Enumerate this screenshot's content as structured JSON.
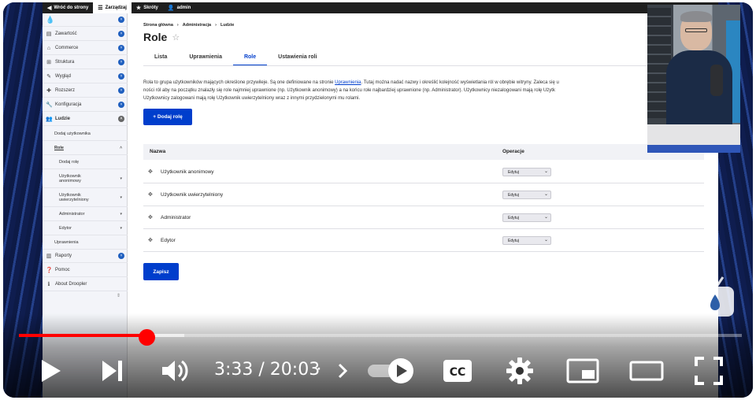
{
  "admin_toolbar": {
    "back": "Wróć do strony",
    "manage": "Zarządzaj",
    "shortcuts": "Skróty",
    "user": "admin"
  },
  "sidebar": {
    "items": [
      {
        "label": "Zawartość",
        "icon": "document-icon"
      },
      {
        "label": "Commerce",
        "icon": "commerce-icon"
      },
      {
        "label": "Struktura",
        "icon": "structure-icon"
      },
      {
        "label": "Wygląd",
        "icon": "brush-icon"
      },
      {
        "label": "Rozszerz",
        "icon": "puzzle-icon"
      },
      {
        "label": "Konfiguracja",
        "icon": "wrench-icon"
      },
      {
        "label": "Ludzie",
        "icon": "people-icon"
      }
    ],
    "people_sub": {
      "add_user": "Dodaj użytkownika",
      "roles": "Role",
      "add_role": "Dodaj rolę",
      "anon": "Użytkownik anonimowy",
      "auth": "Użytkownik uwierzytelniony",
      "admin": "Administrator",
      "editor": "Edytor",
      "permissions": "Uprawnienia"
    },
    "bottom_items": [
      {
        "label": "Raporty",
        "icon": "chart-icon"
      },
      {
        "label": "Pomoc",
        "icon": "help-icon"
      },
      {
        "label": "About Droopler",
        "icon": "info-icon"
      }
    ]
  },
  "breadcrumb": [
    "Strona główna",
    "Administracja",
    "Ludzie"
  ],
  "page_title": "Role",
  "tabs": [
    {
      "label": "Lista",
      "active": false
    },
    {
      "label": "Uprawnienia",
      "active": false
    },
    {
      "label": "Role",
      "active": true
    },
    {
      "label": "Ustawienia roli",
      "active": false
    }
  ],
  "description": {
    "line1_pre": "Rola to grupa użytkowników mających określone przywileje. Są one definiowane na stronie ",
    "line1_link": "Uprawnienia",
    "line1_post": ". Tutaj można nadać nazwy i określić kolejność wyświetlania ról w obrębie witryny. Zaleca się u",
    "line2": "ności ról aby na początku znalazły się role najmniej uprawnione (np. Użytkownik anonimowy) a na końcu role najbardziej uprawnione (np. Administrator). Użytkownicy niezalogowani mają rolę Użytk",
    "line3": "Użytkownicy zalogowani mają rolę Użytkownik uwierzytelniony wraz z innymi przydzielonymi mu rolami."
  },
  "add_role_button": "+ Dodaj rolę",
  "table": {
    "headers": [
      "Nazwa",
      "Operacje"
    ],
    "rows": [
      {
        "name": "Użytkownik anonimowy",
        "op": "Edytuj"
      },
      {
        "name": "Użytkownik uwierzytelniony",
        "op": "Edytuj"
      },
      {
        "name": "Administrator",
        "op": "Edytuj"
      },
      {
        "name": "Edytor",
        "op": "Edytuj"
      }
    ]
  },
  "save_button": "Zapisz",
  "player": {
    "time": "3:33 / 20:03",
    "progress": 0.177,
    "accent": "#ff0000"
  },
  "colors": {
    "primary": "#003ecc",
    "sidebar_bg": "#f3f4f9"
  }
}
